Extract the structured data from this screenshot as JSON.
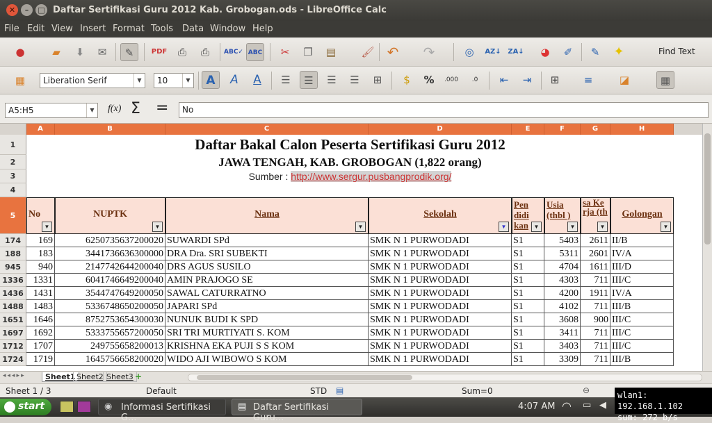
{
  "window": {
    "title": "Daftar Sertifikasi Guru 2012 Kab. Grobogan.ods - LibreOffice Calc"
  },
  "menu": [
    "File",
    "Edit",
    "View",
    "Insert",
    "Format",
    "Tools",
    "Data",
    "Window",
    "Help"
  ],
  "toolbar": {
    "find_text": "Find Text"
  },
  "format_bar": {
    "font_name": "Liberation Serif",
    "font_size": "10"
  },
  "formula_bar": {
    "name_box": "A5:H5",
    "fx": "f(x)",
    "sigma": "Σ",
    "equals": "=",
    "content": "No"
  },
  "columns": [
    "A",
    "B",
    "C",
    "D",
    "E",
    "F",
    "G",
    "H"
  ],
  "sheet": {
    "title_rows": [
      {
        "row": "1",
        "text": "Daftar Bakal Calon Peserta Sertifikasi Guru 2012"
      },
      {
        "row": "2",
        "text": "JAWA TENGAH, KAB. GROBOGAN (1,822 orang)"
      }
    ],
    "source_row": "3",
    "source_label": "Sumber :",
    "source_url": "http://www.sergur.pusbangprodik.org/",
    "empty_row": "4",
    "header_row": "5",
    "headers": {
      "no": "No",
      "nuptk": "NUPTK",
      "nama": "Nama",
      "sekolah": "Sekolah",
      "pendidikan": "Pen didi kan",
      "usia": "Usia (thbl )",
      "masa_kerja": "sa Ke rja (th",
      "golongan": "Golongan"
    },
    "rows": [
      {
        "rn": "174",
        "no": "169",
        "nuptk": "6250735637200020",
        "nama": "SUWARDI SPd",
        "sekolah": "SMK N 1 PURWODADI",
        "pend": "S1",
        "usia": "5403",
        "mk": "2611",
        "gol": "II/B"
      },
      {
        "rn": "188",
        "no": "183",
        "nuptk": "3441736636300000",
        "nama": "DRA Dra. SRI SUBEKTI",
        "sekolah": "SMK N 1 PURWODADI",
        "pend": "S1",
        "usia": "5311",
        "mk": "2601",
        "gol": "IV/A"
      },
      {
        "rn": "945",
        "no": "940",
        "nuptk": "2147742644200040",
        "nama": "DRS AGUS SUSILO",
        "sekolah": "SMK N 1 PURWODADI",
        "pend": "S1",
        "usia": "4704",
        "mk": "1611",
        "gol": "III/D"
      },
      {
        "rn": "1336",
        "no": "1331",
        "nuptk": "6041746649200040",
        "nama": "AMIN PRAJOGO SE",
        "sekolah": "SMK N 1 PURWODADI",
        "pend": "S1",
        "usia": "4303",
        "mk": "711",
        "gol": "III/C"
      },
      {
        "rn": "1436",
        "no": "1431",
        "nuptk": "3544747649200050",
        "nama": "SAWAL CATURRATNO",
        "sekolah": "SMK N 1 PURWODADI",
        "pend": "S1",
        "usia": "4200",
        "mk": "1911",
        "gol": "IV/A"
      },
      {
        "rn": "1488",
        "no": "1483",
        "nuptk": "5336748650200050",
        "nama": "JAPARI SPd",
        "sekolah": "SMK N 1 PURWODADI",
        "pend": "S1",
        "usia": "4102",
        "mk": "711",
        "gol": "III/B"
      },
      {
        "rn": "1651",
        "no": "1646",
        "nuptk": "8752753654300030",
        "nama": "NUNUK BUDI K SPD",
        "sekolah": "SMK N 1 PURWODADI",
        "pend": "S1",
        "usia": "3608",
        "mk": "900",
        "gol": "III/C"
      },
      {
        "rn": "1697",
        "no": "1692",
        "nuptk": "5333755657200050",
        "nama": "SRI TRI MURTIYATI S. KOM",
        "sekolah": "SMK N 1 PURWODADI",
        "pend": "S1",
        "usia": "3411",
        "mk": "711",
        "gol": "III/C"
      },
      {
        "rn": "1712",
        "no": "1707",
        "nuptk": "249755658200013",
        "nama": "KRISHNA EKA PUJI S S KOM",
        "sekolah": "SMK N 1 PURWODADI",
        "pend": "S1",
        "usia": "3403",
        "mk": "711",
        "gol": "III/C"
      },
      {
        "rn": "1724",
        "no": "1719",
        "nuptk": "1645756658200020",
        "nama": "WIDO AJI WIBOWO S KOM",
        "sekolah": "SMK N 1 PURWODADI",
        "pend": "S1",
        "usia": "3309",
        "mk": "711",
        "gol": "III/B"
      }
    ]
  },
  "tabs": [
    "Sheet1",
    "Sheet2",
    "Sheet3"
  ],
  "status": {
    "sheet": "Sheet 1 / 3",
    "style": "Default",
    "mode": "STD",
    "sum": "Sum=0"
  },
  "taskbar": {
    "start": "start",
    "task1": "Informasi Sertifikasi G...",
    "task2": "Daftar Sertifikasi Guru...",
    "time": "4:07 AM"
  },
  "netmon": {
    "line1": "wlan1: 192.168.1.102",
    "line2": "sum: 272 b/s"
  }
}
